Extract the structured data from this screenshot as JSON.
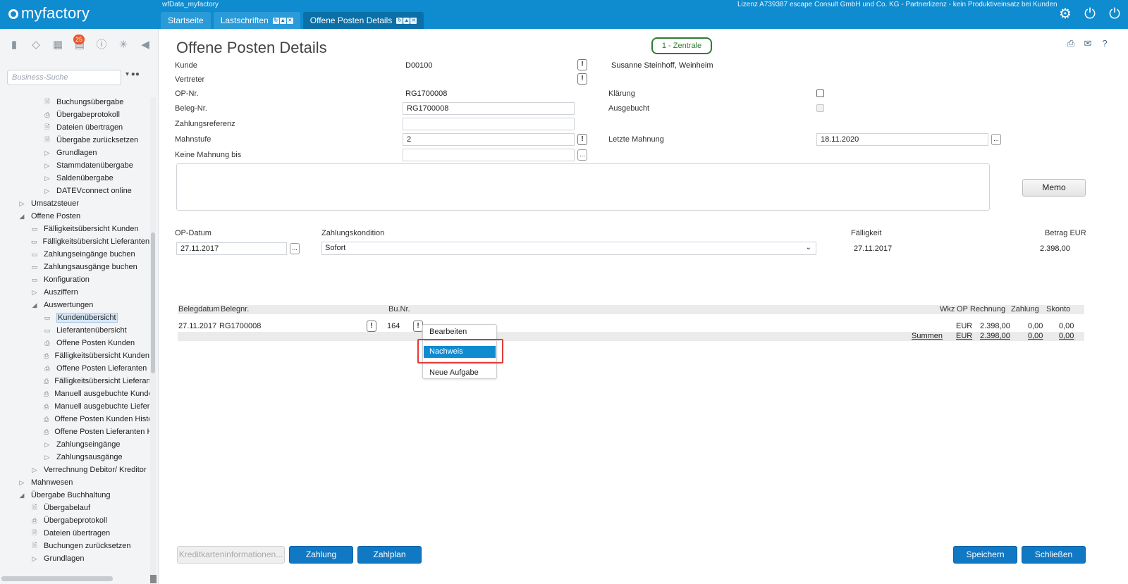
{
  "header": {
    "logo": "myfactory",
    "database": "wfData_myfactory",
    "license": "Lizenz A739387 escape Consult GmbH und Co. KG - Partnerlizenz - kein Produktiveinsatz bei Kunden",
    "tabs": [
      {
        "label": "Startseite"
      },
      {
        "label": "Lastschriften"
      },
      {
        "label": "Offene Posten Details"
      }
    ],
    "icons": [
      "gear-icon",
      "power-icon",
      "power-user-icon"
    ]
  },
  "sidebar": {
    "badge_count": "25",
    "search_placeholder": "Business-Suche",
    "tree": [
      {
        "label": "Buchungsübergabe",
        "icon": "doc",
        "level": 3
      },
      {
        "label": "Übergabeprotokoll",
        "icon": "print",
        "level": 3
      },
      {
        "label": "Dateien übertragen",
        "icon": "doc",
        "level": 3
      },
      {
        "label": "Übergabe zurücksetzen",
        "icon": "doc",
        "level": 3
      },
      {
        "label": "Grundlagen",
        "icon": "closed",
        "level": 3
      },
      {
        "label": "Stammdatenübergabe",
        "icon": "closed",
        "level": 3
      },
      {
        "label": "Saldenübergabe",
        "icon": "closed",
        "level": 3
      },
      {
        "label": "DATEVconnect online",
        "icon": "closed",
        "level": 3
      },
      {
        "label": "Umsatzsteuer",
        "icon": "closed",
        "level": 1
      },
      {
        "label": "Offene Posten",
        "icon": "open",
        "level": 1
      },
      {
        "label": "Fälligkeitsübersicht Kunden",
        "icon": "form",
        "level": 2
      },
      {
        "label": "Fälligkeitsübersicht Lieferanten",
        "icon": "form",
        "level": 2
      },
      {
        "label": "Zahlungseingänge buchen",
        "icon": "form",
        "level": 2
      },
      {
        "label": "Zahlungsausgänge buchen",
        "icon": "form",
        "level": 2
      },
      {
        "label": "Konfiguration",
        "icon": "form",
        "level": 2
      },
      {
        "label": "Ausziffern",
        "icon": "closed",
        "level": 2
      },
      {
        "label": "Auswertungen",
        "icon": "open",
        "level": 2
      },
      {
        "label": "Kundenübersicht",
        "icon": "form",
        "level": 3,
        "selected": true
      },
      {
        "label": "Lieferantenübersicht",
        "icon": "form",
        "level": 3
      },
      {
        "label": "Offene Posten Kunden",
        "icon": "print",
        "level": 3
      },
      {
        "label": "Fälligkeitsübersicht Kunden",
        "icon": "print",
        "level": 3
      },
      {
        "label": "Offene Posten Lieferanten",
        "icon": "print",
        "level": 3
      },
      {
        "label": "Fälligkeitsübersicht Lieferan",
        "icon": "print",
        "level": 3
      },
      {
        "label": "Manuell ausgebuchte Kunde",
        "icon": "print",
        "level": 3
      },
      {
        "label": "Manuell ausgebuchte Liefer",
        "icon": "print",
        "level": 3
      },
      {
        "label": "Offene Posten Kunden Histo",
        "icon": "print",
        "level": 3
      },
      {
        "label": "Offene Posten Lieferanten H",
        "icon": "print",
        "level": 3
      },
      {
        "label": "Zahlungseingänge",
        "icon": "closed",
        "level": 3
      },
      {
        "label": "Zahlungsausgänge",
        "icon": "closed",
        "level": 3
      },
      {
        "label": "Verrechnung Debitor/ Kreditor",
        "icon": "closed",
        "level": 2
      },
      {
        "label": "Mahnwesen",
        "icon": "closed",
        "level": 1
      },
      {
        "label": "Übergabe Buchhaltung",
        "icon": "open",
        "level": 1
      },
      {
        "label": "Übergabelauf",
        "icon": "doc",
        "level": 2
      },
      {
        "label": "Übergabeprotokoll",
        "icon": "print",
        "level": 2
      },
      {
        "label": "Dateien übertragen",
        "icon": "doc",
        "level": 2
      },
      {
        "label": "Buchungen zurücksetzen",
        "icon": "doc",
        "level": 2
      },
      {
        "label": "Grundlagen",
        "icon": "closed",
        "level": 2
      }
    ]
  },
  "main": {
    "title": "Offene Posten Details",
    "branch": "1 - Zentrale",
    "labels": {
      "kunde": "Kunde",
      "vertreter": "Vertreter",
      "op_nr": "OP-Nr.",
      "beleg_nr": "Beleg-Nr.",
      "zahlungsreferenz": "Zahlungsreferenz",
      "mahnstufe": "Mahnstufe",
      "keine_mahnung_bis": "Keine Mahnung bis",
      "klaerung": "Klärung",
      "ausgebucht": "Ausgebucht",
      "letzte_mahnung": "Letzte Mahnung",
      "op_datum": "OP-Datum",
      "zahlungskondition": "Zahlungskondition",
      "faelligkeit": "Fälligkeit",
      "betrag_eur": "Betrag EUR"
    },
    "values": {
      "kunde": "D00100",
      "kunde_name": "Susanne Steinhoff, Weinheim",
      "op_nr": "RG1700008",
      "beleg_nr": "RG1700008",
      "zahlungsreferenz": "",
      "mahnstufe": "2",
      "keine_mahnung_bis": "",
      "letzte_mahnung": "18.11.2020",
      "op_datum": "27.11.2017",
      "zahlungskondition": "Sofort",
      "faelligkeit": "27.11.2017",
      "betrag": "2.398,00"
    },
    "memo_button": "Memo"
  },
  "table": {
    "headers": {
      "belegdatum": "Belegdatum",
      "belegnr": "Belegnr.",
      "bunr": "Bu.Nr.",
      "wkz": "Wkz",
      "op": "OP",
      "rechnung": "Rechnung",
      "zahlung": "Zahlung",
      "skonto": "Skonto"
    },
    "row": {
      "belegdatum": "27.11.2017",
      "belegnr": "RG1700008",
      "bunr": "164",
      "wkz": "EUR",
      "rechnung": "2.398,00",
      "zahlung": "0,00",
      "skonto": "0,00"
    },
    "sum": {
      "label": "Summen",
      "wkz": "EUR",
      "rechnung": "2.398,00",
      "zahlung": "0,00",
      "skonto": "0,00"
    }
  },
  "context_menu": {
    "items": [
      "Bearbeiten",
      "Nachweis",
      "Neue Aufgabe"
    ],
    "highlighted": "Nachweis"
  },
  "buttons": {
    "kreditkarte": "Kreditkarteninformationen...",
    "zahlung": "Zahlung",
    "zahlplan": "Zahlplan",
    "speichern": "Speichern",
    "schliessen": "Schließen"
  }
}
